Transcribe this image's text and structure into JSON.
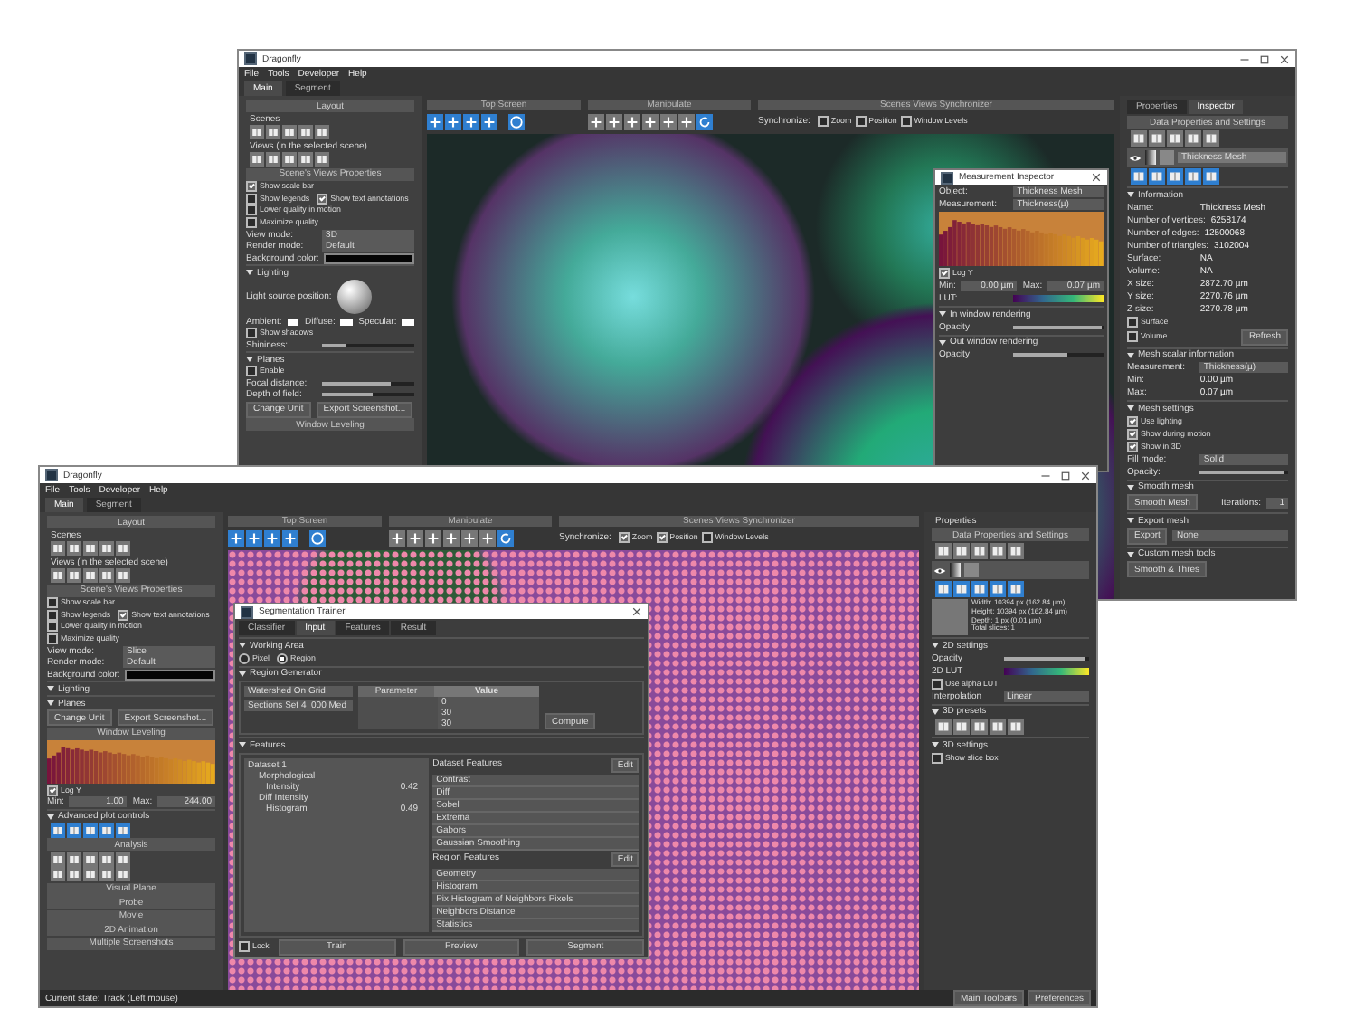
{
  "windows": [
    {
      "title": "Dragonfly",
      "menu": [
        "File",
        "Tools",
        "Developer",
        "Help"
      ],
      "tabs": [
        {
          "label": "Main",
          "selected": true
        },
        {
          "label": "Segment",
          "selected": false
        }
      ],
      "panes": [
        {
          "kind": "left",
          "rows": [
            {
              "kind": "bar",
              "label": "Layout"
            },
            {
              "kind": "label",
              "label": "Scenes"
            },
            {
              "kind": "icons"
            },
            {
              "kind": "label",
              "label": "Views (in the selected scene)"
            },
            {
              "kind": "icons"
            },
            {
              "kind": "bar",
              "label": "Scene's Views Properties"
            },
            {
              "kind": "checks",
              "items": [
                {
                  "label": "Show scale bar",
                  "checked": true
                }
              ]
            },
            {
              "kind": "checks",
              "items": [
                {
                  "label": "Show legends",
                  "checked": false
                },
                {
                  "label": "Show text annotations",
                  "checked": true
                }
              ]
            },
            {
              "kind": "checks",
              "items": [
                {
                  "label": "Lower quality in motion",
                  "checked": false
                },
                {
                  "label": "Maximize quality",
                  "checked": false
                }
              ]
            },
            {
              "kind": "select",
              "label": "View mode:",
              "value": "3D"
            },
            {
              "kind": "select",
              "label": "Render mode:",
              "value": "Default"
            },
            {
              "kind": "color",
              "label": "Background color:"
            },
            {
              "kind": "group",
              "label": "Lighting"
            },
            {
              "kind": "sphere",
              "label": "Light source position:"
            },
            {
              "kind": "swatches",
              "items": [
                "Ambient:",
                "Diffuse:",
                "Specular:"
              ]
            },
            {
              "kind": "checks",
              "items": [
                {
                  "label": "Show shadows",
                  "checked": false
                }
              ]
            },
            {
              "kind": "slider",
              "label": "Shininess:",
              "level": 0.25
            },
            {
              "kind": "group",
              "label": "Planes"
            },
            {
              "kind": "checks",
              "items": [
                {
                  "label": "Enable",
                  "checked": false
                }
              ]
            },
            {
              "kind": "slider",
              "label": "Focal distance:",
              "level": 0.75
            },
            {
              "kind": "slider",
              "label": "Depth of field:",
              "level": 0.55
            },
            {
              "kind": "buttons",
              "items": [
                "Change Unit",
                "Export Screenshot..."
              ]
            },
            {
              "kind": "bar",
              "label": "Window Leveling"
            }
          ]
        },
        {
          "kind": "center",
          "toolbars": [
            "Top Screen",
            "Manipulate",
            "Scenes Views Synchronizer"
          ],
          "sync": {
            "label": "Synchronize:",
            "items": [
              {
                "label": "Zoom",
                "checked": false
              },
              {
                "label": "Position",
                "checked": false
              },
              {
                "label": "Window Levels",
                "checked": false
              }
            ]
          }
        },
        {
          "kind": "right",
          "rows": [
            {
              "kind": "tabs",
              "items": [
                {
                  "label": "Properties",
                  "selected": false
                },
                {
                  "label": "Inspector",
                  "selected": true
                }
              ]
            },
            {
              "kind": "bar",
              "label": "Data Properties and Settings"
            },
            {
              "kind": "icons"
            },
            {
              "kind": "layer",
              "label": "Thickness Mesh"
            },
            {
              "kind": "toolicons"
            },
            {
              "kind": "group",
              "label": "Information"
            },
            {
              "kind": "info",
              "label": "Name:",
              "value": "Thickness Mesh"
            },
            {
              "kind": "info",
              "label": "Number of vertices:",
              "value": "6258174"
            },
            {
              "kind": "info",
              "label": "Number of edges:",
              "value": "12500068"
            },
            {
              "kind": "info",
              "label": "Number of triangles:",
              "value": "3102004"
            },
            {
              "kind": "info",
              "label": "Surface:",
              "value": "NA"
            },
            {
              "kind": "info",
              "label": "Volume:",
              "value": "NA"
            },
            {
              "kind": "info",
              "label": "X size:",
              "value": "2872.70 µm"
            },
            {
              "kind": "info",
              "label": "Y size:",
              "value": "2270.76 µm"
            },
            {
              "kind": "info",
              "label": "Z size:",
              "value": "2270.78 µm"
            },
            {
              "kind": "checks",
              "items": [
                {
                  "label": "Surface",
                  "checked": false
                }
              ]
            },
            {
              "kind": "checks",
              "items": [
                {
                  "label": "Volume",
                  "checked": false
                }
              ],
              "button": "Refresh"
            },
            {
              "kind": "group",
              "label": "Mesh scalar information"
            },
            {
              "kind": "select",
              "label": "Measurement:",
              "value": "Thickness(µ)"
            },
            {
              "kind": "info",
              "label": "Min:",
              "value": "0.00 µm"
            },
            {
              "kind": "info",
              "label": "Max:",
              "value": "0.07 µm"
            },
            {
              "kind": "group",
              "label": "Mesh settings"
            },
            {
              "kind": "checks",
              "items": [
                {
                  "label": "Use lighting",
                  "checked": true
                }
              ]
            },
            {
              "kind": "checks",
              "items": [
                {
                  "label": "Show during motion",
                  "checked": true
                }
              ]
            },
            {
              "kind": "checks",
              "items": [
                {
                  "label": "Show in 3D",
                  "checked": true
                }
              ]
            },
            {
              "kind": "select",
              "label": "Fill mode:",
              "value": "Solid"
            },
            {
              "kind": "slider",
              "label": "Opacity:",
              "level": 0.95
            },
            {
              "kind": "group",
              "label": "Smooth mesh"
            },
            {
              "kind": "buttons",
              "items": [
                "Smooth Mesh"
              ],
              "field": {
                "label": "Iterations:",
                "value": "1"
              }
            },
            {
              "kind": "group",
              "label": "Export mesh"
            },
            {
              "kind": "buttons",
              "items": [
                "Export"
              ],
              "select": "None"
            },
            {
              "kind": "group",
              "label": "Custom mesh tools"
            },
            {
              "kind": "buttons",
              "items": [
                "Smooth & Thres"
              ]
            }
          ]
        },
        {
          "kind": "dialog",
          "title": "Measurement Inspector",
          "rows": [
            {
              "kind": "select",
              "label": "Object:",
              "value": "Thickness Mesh"
            },
            {
              "kind": "select",
              "label": "Measurement:",
              "value": "Thickness(µ)"
            },
            {
              "kind": "histogram"
            },
            {
              "kind": "checks",
              "items": [
                {
                  "label": "Log Y",
                  "checked": true
                }
              ]
            },
            {
              "kind": "range",
              "items": [
                {
                  "label": "Min:",
                  "value": "0.00 µm"
                },
                {
                  "label": "Max:",
                  "value": "0.07 µm"
                }
              ]
            },
            {
              "kind": "lut",
              "label": "LUT:"
            },
            {
              "kind": "group",
              "label": "In window rendering"
            },
            {
              "kind": "slider",
              "label": "Opacity",
              "level": 0.97
            },
            {
              "kind": "group",
              "label": "Out window rendering"
            },
            {
              "kind": "slider",
              "label": "Opacity",
              "level": 0.6
            }
          ]
        }
      ]
    },
    {
      "title": "Dragonfly",
      "menu": [
        "File",
        "Tools",
        "Developer",
        "Help"
      ],
      "tabs": [
        {
          "label": "Main",
          "selected": true
        },
        {
          "label": "Segment",
          "selected": false
        }
      ],
      "panes": [
        {
          "kind": "left",
          "rows": [
            {
              "kind": "bar",
              "label": "Layout"
            },
            {
              "kind": "label",
              "label": "Scenes"
            },
            {
              "kind": "icons"
            },
            {
              "kind": "label",
              "label": "Views (in the selected scene)"
            },
            {
              "kind": "icons"
            },
            {
              "kind": "bar",
              "label": "Scene's Views Properties"
            },
            {
              "kind": "checks",
              "items": [
                {
                  "label": "Show scale bar",
                  "checked": false
                }
              ]
            },
            {
              "kind": "checks",
              "items": [
                {
                  "label": "Show legends",
                  "checked": false
                },
                {
                  "label": "Show text annotations",
                  "checked": true
                }
              ]
            },
            {
              "kind": "checks",
              "items": [
                {
                  "label": "Lower quality in motion",
                  "checked": false
                },
                {
                  "label": "Maximize quality",
                  "checked": false
                }
              ]
            },
            {
              "kind": "select",
              "label": "View mode:",
              "value": "Slice"
            },
            {
              "kind": "select",
              "label": "Render mode:",
              "value": "Default"
            },
            {
              "kind": "color",
              "label": "Background color:"
            },
            {
              "kind": "group",
              "label": "Lighting"
            },
            {
              "kind": "group",
              "label": "Planes"
            },
            {
              "kind": "buttons",
              "items": [
                "Change Unit",
                "Export Screenshot..."
              ]
            },
            {
              "kind": "bar",
              "label": "Window Leveling"
            },
            {
              "kind": "histogram"
            },
            {
              "kind": "checks",
              "items": [
                {
                  "label": "Log Y",
                  "checked": true
                }
              ]
            },
            {
              "kind": "range",
              "items": [
                {
                  "label": "Min:",
                  "value": "1.00"
                },
                {
                  "label": "Max:",
                  "value": "244.00"
                }
              ]
            },
            {
              "kind": "group",
              "label": "Advanced plot controls"
            },
            {
              "kind": "toolicons"
            },
            {
              "kind": "bar",
              "label": "Analysis"
            },
            {
              "kind": "icons"
            },
            {
              "kind": "icons"
            },
            {
              "kind": "bar",
              "label": "Visual Plane"
            },
            {
              "kind": "bar",
              "label": "Probe"
            },
            {
              "kind": "bar",
              "label": "Movie"
            },
            {
              "kind": "bar",
              "label": "2D Animation"
            },
            {
              "kind": "bar",
              "label": "Multiple Screenshots"
            }
          ]
        },
        {
          "kind": "center",
          "toolbars": [
            "Top Screen",
            "Manipulate",
            "Scenes Views Synchronizer"
          ],
          "sync": {
            "label": "Synchronize:",
            "items": [
              {
                "label": "Zoom",
                "checked": true
              },
              {
                "label": "Position",
                "checked": true
              },
              {
                "label": "Window Levels",
                "checked": false
              }
            ]
          }
        },
        {
          "kind": "right",
          "rows": [
            {
              "kind": "label",
              "label": "Properties"
            },
            {
              "kind": "bar",
              "label": "Data Properties and Settings"
            },
            {
              "kind": "icons"
            },
            {
              "kind": "layer"
            },
            {
              "kind": "toolicons"
            },
            {
              "kind": "thumbinfo",
              "lines": [
                "Width: 10394 px (162.84 µm)",
                "Height: 10394 px (162.84 µm)",
                "Depth: 1 px (0.01 µm)",
                "Total slices: 1"
              ]
            },
            {
              "kind": "group",
              "label": "2D settings"
            },
            {
              "kind": "slider",
              "label": "Opacity",
              "level": 0.95
            },
            {
              "kind": "lut",
              "label": "2D LUT"
            },
            {
              "kind": "checks",
              "items": [
                {
                  "label": "Use alpha LUT",
                  "checked": false
                }
              ]
            },
            {
              "kind": "select",
              "label": "Interpolation",
              "value": "Linear"
            },
            {
              "kind": "group",
              "label": "3D presets"
            },
            {
              "kind": "icons"
            },
            {
              "kind": "group",
              "label": "3D settings"
            },
            {
              "kind": "checks",
              "items": [
                {
                  "label": "Show slice box",
                  "checked": false
                }
              ]
            }
          ]
        },
        {
          "kind": "dialog",
          "title": "Segmentation Trainer",
          "rows": [
            {
              "kind": "tabs",
              "items": [
                {
                  "label": "Classifier",
                  "selected": false
                },
                {
                  "label": "Input",
                  "selected": true
                },
                {
                  "label": "Features",
                  "selected": false
                },
                {
                  "label": "Result",
                  "selected": false
                }
              ]
            },
            {
              "kind": "group",
              "label": "Working Area"
            },
            {
              "kind": "radios",
              "items": [
                {
                  "label": "Pixel",
                  "selected": false
                },
                {
                  "label": "Region",
                  "selected": true
                }
              ]
            },
            {
              "kind": "group",
              "label": "Region Generator"
            },
            {
              "kind": "generator",
              "selects": [
                "Watershed On Grid",
                "Sections Set 4_000 Med"
              ],
              "columns": [
                "Parameter",
                "Value"
              ],
              "values": [
                "0",
                "30",
                "30"
              ],
              "button": "Compute"
            },
            {
              "kind": "group",
              "label": "Features"
            },
            {
              "kind": "features",
              "tree": [
                {
                  "label": "Dataset 1",
                  "children": [
                    {
                      "label": "Morphological",
                      "children": [
                        {
                          "label": "Intensity",
                          "value": "0.42"
                        }
                      ]
                    },
                    {
                      "label": "Diff Intensity",
                      "children": [
                        {
                          "label": "Histogram",
                          "value": "0.49"
                        }
                      ]
                    }
                  ]
                }
              ],
              "lists": [
                {
                  "label": "Dataset Features",
                  "action": "Edit",
                  "items": [
                    "Contrast",
                    "Diff",
                    "Sobel",
                    "Extrema",
                    "Gabors",
                    "Gaussian Smoothing"
                  ]
                },
                {
                  "label": "Region Features",
                  "action": "Edit",
                  "items": [
                    "Geometry",
                    "Histogram",
                    "Pix Histogram of Neighbors Pixels",
                    "Neighbors Distance",
                    "Statistics"
                  ]
                }
              ]
            },
            {
              "kind": "footer",
              "check": {
                "label": "Lock",
                "checked": false
              },
              "items": [
                "Train",
                "Preview",
                "Segment"
              ]
            }
          ]
        }
      ],
      "status": {
        "text": "Current state: Track (Left mouse)",
        "buttons": [
          "Main Toolbars",
          "Preferences"
        ]
      }
    }
  ]
}
